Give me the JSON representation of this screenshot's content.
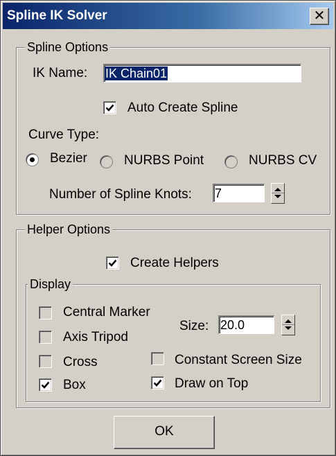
{
  "window": {
    "title": "Spline IK Solver",
    "close_glyph": "✕"
  },
  "spline_options": {
    "group_label": "Spline Options",
    "ik_name_label": "IK Name:",
    "ik_name_value": "IK Chain01",
    "auto_create_spline": {
      "label": "Auto Create Spline",
      "checked": true
    },
    "curve_type_label": "Curve Type:",
    "curve_types": [
      {
        "label": "Bezier",
        "selected": true
      },
      {
        "label": "NURBS Point",
        "selected": false
      },
      {
        "label": "NURBS CV",
        "selected": false
      }
    ],
    "knots_label": "Number of Spline Knots:",
    "knots_value": "7"
  },
  "helper_options": {
    "group_label": "Helper Options",
    "create_helpers": {
      "label": "Create Helpers",
      "checked": true
    },
    "display": {
      "group_label": "Display",
      "central_marker": {
        "label": "Central Marker",
        "checked": false
      },
      "axis_tripod": {
        "label": "Axis Tripod",
        "checked": false
      },
      "cross": {
        "label": "Cross",
        "checked": false
      },
      "box": {
        "label": "Box",
        "checked": true
      },
      "size_label": "Size:",
      "size_value": "20.0",
      "constant_screen_size": {
        "label": "Constant Screen Size",
        "checked": false
      },
      "draw_on_top": {
        "label": "Draw on Top",
        "checked": true
      }
    }
  },
  "ok_label": "OK"
}
